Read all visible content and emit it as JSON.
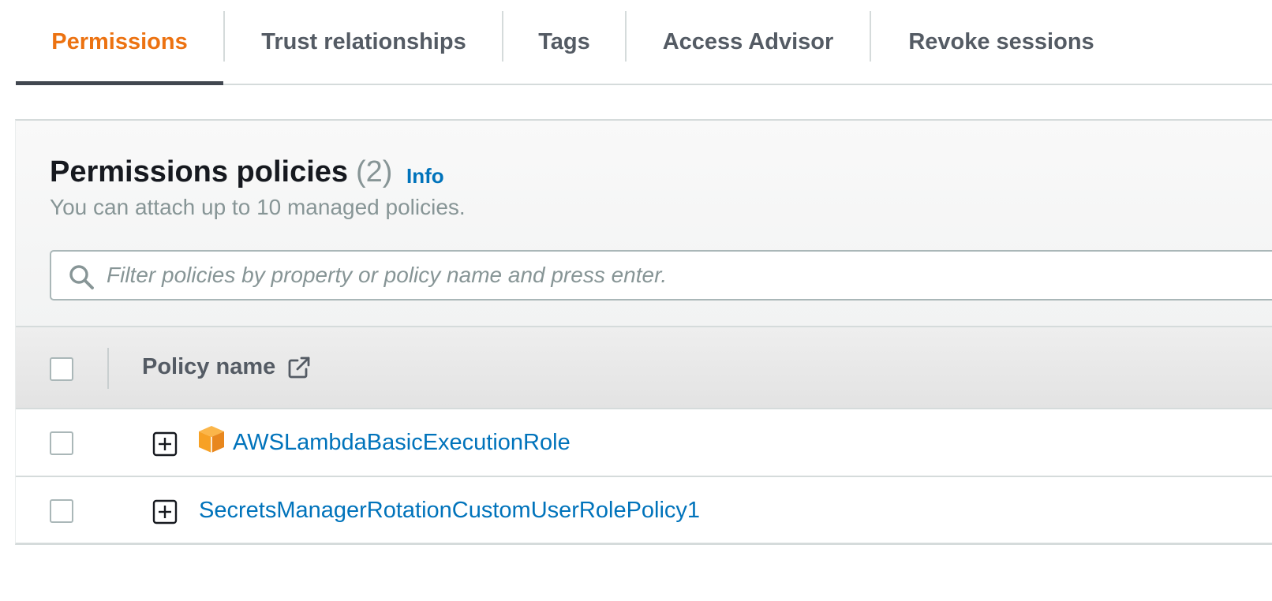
{
  "tabs": [
    {
      "label": "Permissions",
      "active": true
    },
    {
      "label": "Trust relationships",
      "active": false
    },
    {
      "label": "Tags",
      "active": false
    },
    {
      "label": "Access Advisor",
      "active": false
    },
    {
      "label": "Revoke sessions",
      "active": false
    }
  ],
  "panel": {
    "title": "Permissions policies",
    "count": "(2)",
    "info_label": "Info",
    "description": "You can attach up to 10 managed policies."
  },
  "search": {
    "placeholder": "Filter policies by property or policy name and press enter.",
    "value": ""
  },
  "table": {
    "columns": [
      {
        "label": "Policy name",
        "icon": "external-link-icon"
      }
    ],
    "rows": [
      {
        "name": "AWSLambdaBasicExecutionRole",
        "aws_managed": true,
        "selected": false
      },
      {
        "name": "SecretsManagerRotationCustomUserRolePolicy1",
        "aws_managed": false,
        "selected": false
      }
    ]
  },
  "colors": {
    "active_tab": "#ec7211",
    "link": "#0073bb",
    "aws_managed_icon": "#f7a125"
  }
}
